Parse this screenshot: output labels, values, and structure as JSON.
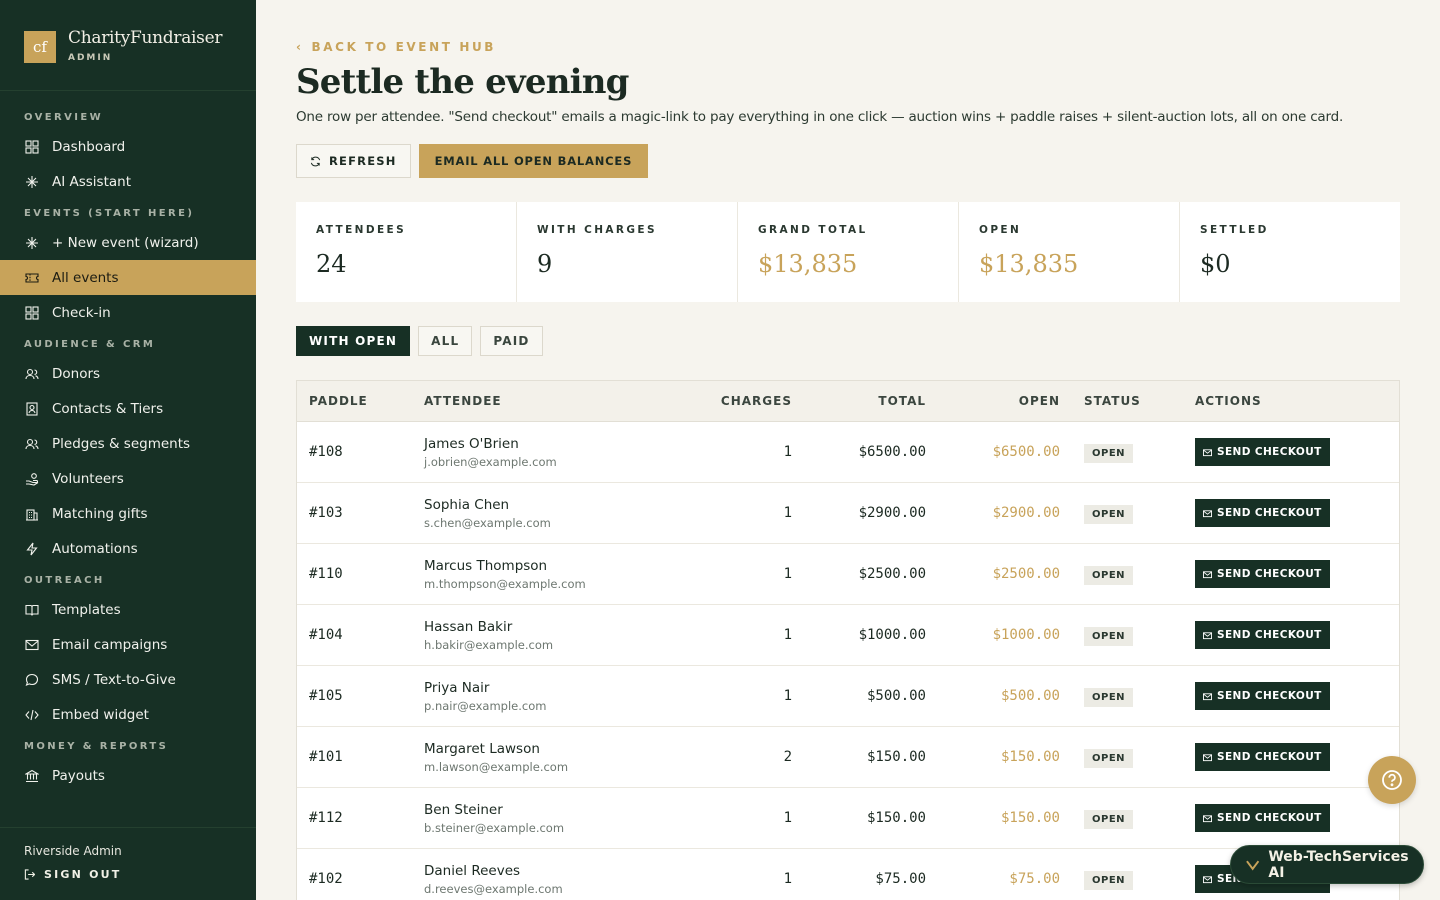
{
  "brand": {
    "logo": "cf",
    "name": "CharityFundraiser",
    "role": "ADMIN"
  },
  "nav": {
    "sections": [
      {
        "title": "OVERVIEW",
        "items": [
          {
            "label": "Dashboard",
            "icon": "grid-icon"
          },
          {
            "label": "AI Assistant",
            "icon": "sparkle-icon"
          }
        ]
      },
      {
        "title": "EVENTS (START HERE)",
        "items": [
          {
            "label": "+ New event (wizard)",
            "icon": "sparkle-icon"
          },
          {
            "label": "All events",
            "icon": "ticket-icon",
            "active": true
          },
          {
            "label": "Check-in",
            "icon": "grid-icon"
          }
        ]
      },
      {
        "title": "AUDIENCE & CRM",
        "items": [
          {
            "label": "Donors",
            "icon": "users-icon"
          },
          {
            "label": "Contacts & Tiers",
            "icon": "contact-icon"
          },
          {
            "label": "Pledges & segments",
            "icon": "users-icon"
          },
          {
            "label": "Volunteers",
            "icon": "hand-icon"
          },
          {
            "label": "Matching gifts",
            "icon": "building-icon"
          },
          {
            "label": "Automations",
            "icon": "bolt-icon"
          }
        ]
      },
      {
        "title": "OUTREACH",
        "items": [
          {
            "label": "Templates",
            "icon": "book-icon"
          },
          {
            "label": "Email campaigns",
            "icon": "mail-icon"
          },
          {
            "label": "SMS / Text-to-Give",
            "icon": "chat-icon"
          },
          {
            "label": "Embed widget",
            "icon": "code-icon"
          }
        ]
      },
      {
        "title": "MONEY & REPORTS",
        "items": [
          {
            "label": "Payouts",
            "icon": "bank-icon"
          }
        ]
      }
    ]
  },
  "footer": {
    "user": "Riverside Admin",
    "signout": "SIGN OUT"
  },
  "header": {
    "back": "BACK TO EVENT HUB",
    "title": "Settle the evening",
    "subtitle": "One row per attendee. \"Send checkout\" emails a magic-link to pay everything in one click — auction wins + paddle raises + silent-auction lots, all on one card.",
    "refresh": "REFRESH",
    "email_all": "EMAIL ALL OPEN BALANCES"
  },
  "stats": [
    {
      "label": "ATTENDEES",
      "value": "24",
      "gold": false
    },
    {
      "label": "WITH CHARGES",
      "value": "9",
      "gold": false
    },
    {
      "label": "GRAND TOTAL",
      "value": "$13,835",
      "gold": true
    },
    {
      "label": "OPEN",
      "value": "$13,835",
      "gold": true
    },
    {
      "label": "SETTLED",
      "value": "$0",
      "gold": false
    }
  ],
  "filters": [
    "WITH OPEN",
    "ALL",
    "PAID"
  ],
  "table": {
    "headers": [
      "PADDLE",
      "ATTENDEE",
      "CHARGES",
      "TOTAL",
      "OPEN",
      "STATUS",
      "ACTIONS"
    ],
    "action_label": "SEND CHECKOUT",
    "rows": [
      {
        "paddle": "#108",
        "name": "James O'Brien",
        "email": "j.obrien@example.com",
        "charges": "1",
        "total": "$6500.00",
        "open": "$6500.00",
        "status": "OPEN"
      },
      {
        "paddle": "#103",
        "name": "Sophia Chen",
        "email": "s.chen@example.com",
        "charges": "1",
        "total": "$2900.00",
        "open": "$2900.00",
        "status": "OPEN"
      },
      {
        "paddle": "#110",
        "name": "Marcus Thompson",
        "email": "m.thompson@example.com",
        "charges": "1",
        "total": "$2500.00",
        "open": "$2500.00",
        "status": "OPEN"
      },
      {
        "paddle": "#104",
        "name": "Hassan Bakir",
        "email": "h.bakir@example.com",
        "charges": "1",
        "total": "$1000.00",
        "open": "$1000.00",
        "status": "OPEN"
      },
      {
        "paddle": "#105",
        "name": "Priya Nair",
        "email": "p.nair@example.com",
        "charges": "1",
        "total": "$500.00",
        "open": "$500.00",
        "status": "OPEN"
      },
      {
        "paddle": "#101",
        "name": "Margaret Lawson",
        "email": "m.lawson@example.com",
        "charges": "2",
        "total": "$150.00",
        "open": "$150.00",
        "status": "OPEN"
      },
      {
        "paddle": "#112",
        "name": "Ben Steiner",
        "email": "b.steiner@example.com",
        "charges": "1",
        "total": "$150.00",
        "open": "$150.00",
        "status": "OPEN"
      },
      {
        "paddle": "#102",
        "name": "Daniel Reeves",
        "email": "d.reeves@example.com",
        "charges": "1",
        "total": "$75.00",
        "open": "$75.00",
        "status": "OPEN"
      }
    ]
  },
  "chat_widget": {
    "label": "Web-TechServices AI"
  },
  "colors": {
    "sidebar": "#173025",
    "accent": "#c8a35a",
    "background": "#f6f4ee"
  }
}
